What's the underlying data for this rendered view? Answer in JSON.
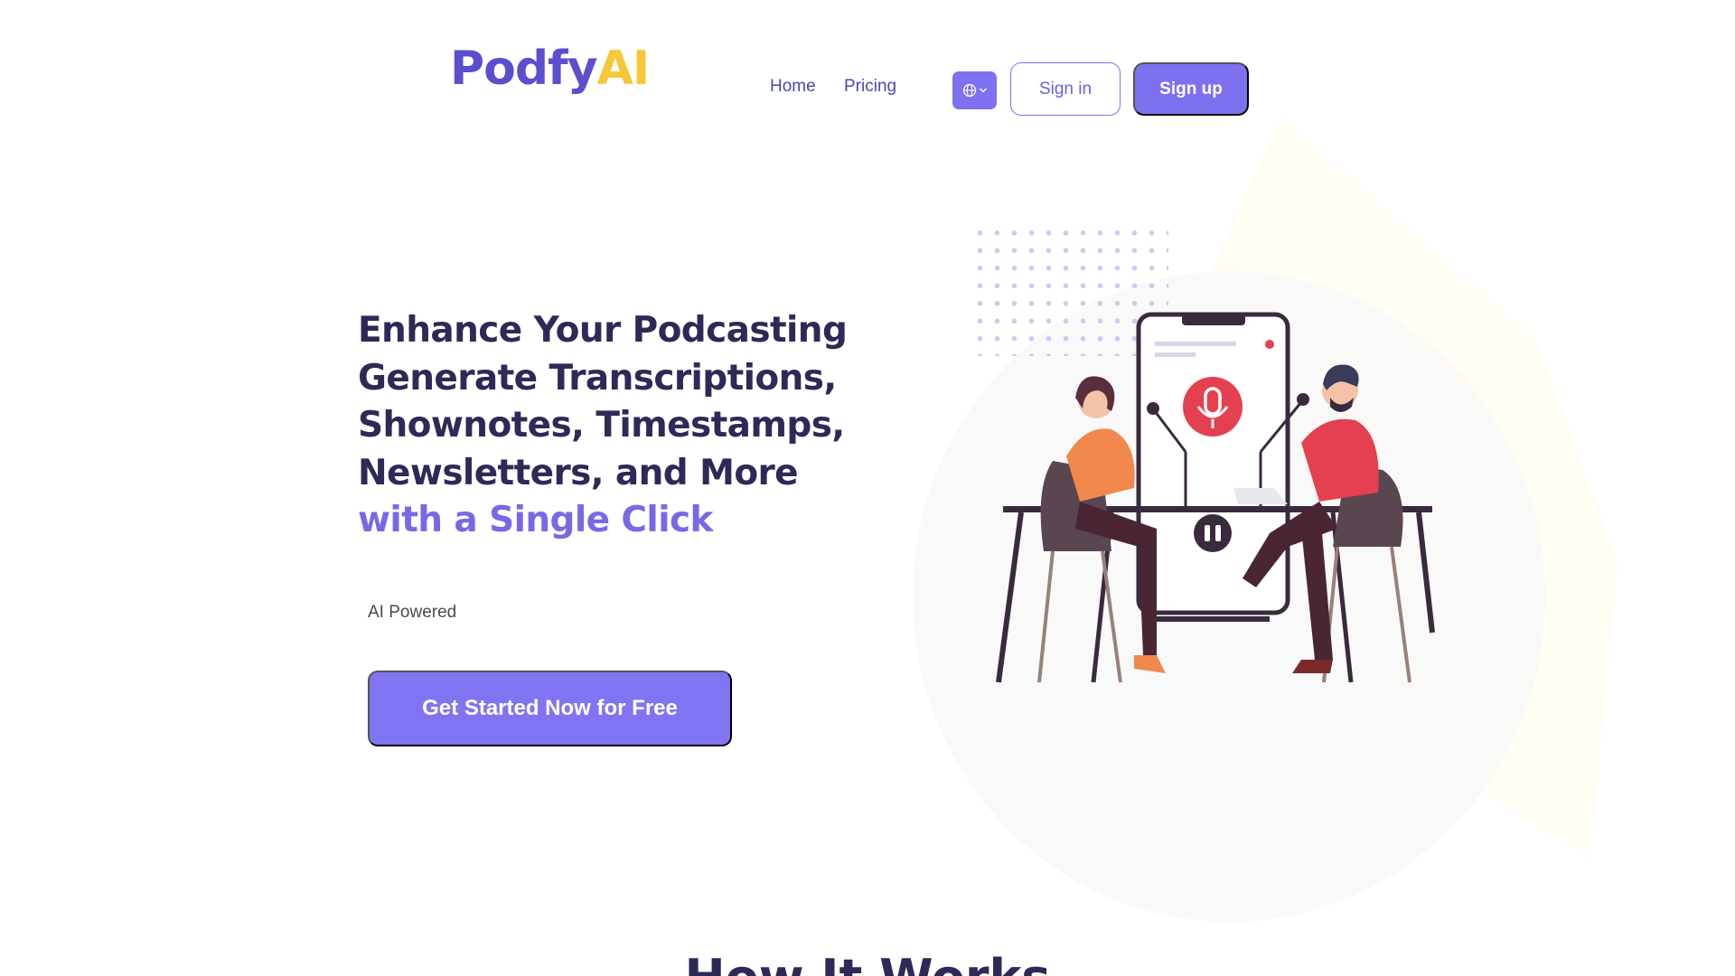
{
  "brand": {
    "logo_part1": "Podfy",
    "logo_part2": "AI"
  },
  "nav": {
    "home": "Home",
    "pricing": "Pricing"
  },
  "header": {
    "language_icon": "globe-icon",
    "dropdown_icon": "chevron-down-icon",
    "sign_in": "Sign in",
    "sign_up": "Sign up"
  },
  "hero": {
    "title_lines": [
      "Enhance Your Podcasting",
      "Generate Transcriptions,",
      "Shownotes, Timestamps,",
      "Newsletters, and More"
    ],
    "title_accent": "with a Single Click",
    "tagline": "AI Powered",
    "cta": "Get Started Now for Free"
  },
  "how_it_works": {
    "heading": "How It Works"
  },
  "colors": {
    "brand_purple": "#5b4fce",
    "brand_yellow": "#f6c838",
    "button_purple": "#7d71ef",
    "heading_dark": "#2e2a57",
    "illustration_red": "#e5404f",
    "illustration_orange": "#f0884e"
  }
}
